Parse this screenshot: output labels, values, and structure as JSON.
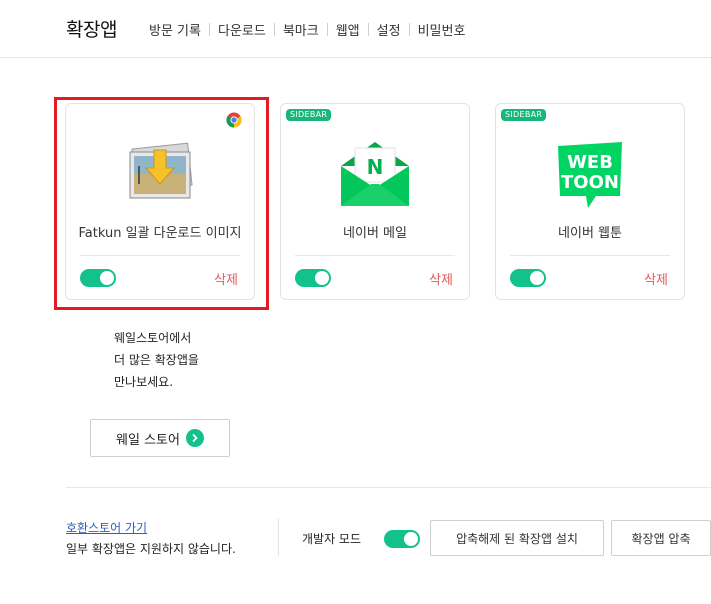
{
  "header": {
    "title": "확장앱",
    "nav": [
      "방문 기록",
      "다운로드",
      "북마크",
      "웹앱",
      "설정",
      "비밀번호"
    ]
  },
  "extensions": [
    {
      "name": "Fatkun 일괄 다운로드 이미지",
      "badge": "chrome-icon",
      "enabled": true,
      "delete_label": "삭제"
    },
    {
      "name": "네이버 메일",
      "tag": "SIDEBAR",
      "enabled": true,
      "delete_label": "삭제"
    },
    {
      "name": "네이버 웹툰",
      "tag": "SIDEBAR",
      "enabled": true,
      "delete_label": "삭제",
      "icon_text": [
        "WEB",
        "TOON"
      ]
    }
  ],
  "mail_icon_letter": "N",
  "store": {
    "lines": [
      "웨일스토어에서",
      "더 많은 확장앱을",
      "만나보세요."
    ],
    "button_label": "웨일 스토어"
  },
  "footer": {
    "compat_link": "호환스토어 가기",
    "compat_note": "일부 확장앱은 지원하지 않습니다.",
    "dev_mode_label": "개발자 모드",
    "dev_mode_enabled": true,
    "load_unpacked_label": "압축해제 된 확장앱 설치",
    "pack_label": "확장앱 압축"
  },
  "colors": {
    "accent": "#12c28a",
    "delete": "#e35a5a",
    "highlight": "#e01b22",
    "link": "#2d5fc3"
  }
}
